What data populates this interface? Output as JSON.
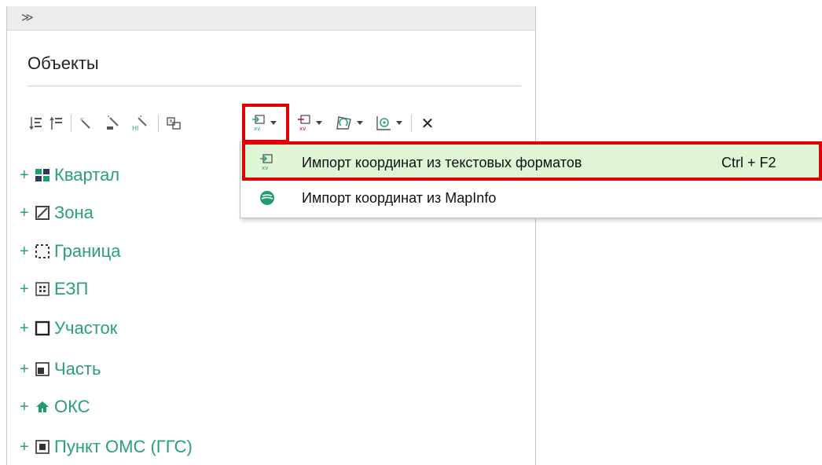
{
  "panel": {
    "expand_glyph": "≫",
    "title": "Объекты"
  },
  "toolbar": {
    "icons": [
      "sort-desc-icon",
      "sort-asc-icon",
      "wand-icon",
      "wand-object-icon",
      "wand-hi-icon",
      "copy-objects-icon",
      "import-xy-icon",
      "export-xy-icon",
      "polygon-edit-icon",
      "target-properties-icon",
      "delete-icon"
    ],
    "close_glyph": "✕"
  },
  "tree": {
    "expand_glyph": "+",
    "items": [
      {
        "label": "Квартал",
        "icon": "block-icon"
      },
      {
        "label": "Зона",
        "icon": "zone-icon"
      },
      {
        "label": "Граница",
        "icon": "border-icon"
      },
      {
        "label": "ЕЗП",
        "icon": "ezp-icon"
      },
      {
        "label": "Участок",
        "icon": "parcel-icon"
      },
      {
        "label": "Часть",
        "icon": "part-icon"
      },
      {
        "label": "ОКС",
        "icon": "house-icon"
      },
      {
        "label": "Пункт ОМС (ГГС)",
        "icon": "survey-point-icon"
      }
    ]
  },
  "dropdown": {
    "items": [
      {
        "label": "Импорт координат из текстовых форматов",
        "shortcut": "Ctrl + F2",
        "icon": "import-xy-icon"
      },
      {
        "label": "Импорт координат из MapInfo",
        "shortcut": "",
        "icon": "mapinfo-icon"
      }
    ]
  },
  "colors": {
    "accent_green": "#2aa073",
    "highlight_red": "#e00000",
    "menu_highlight_bg": "#dff5d4"
  }
}
